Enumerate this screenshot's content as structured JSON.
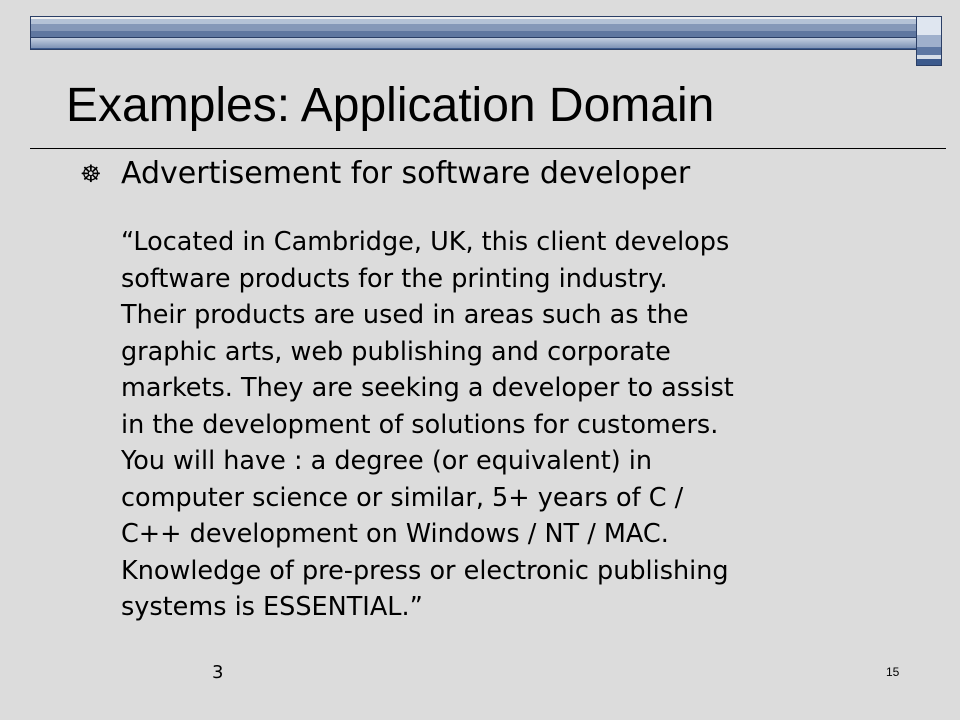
{
  "slide": {
    "title": "Examples: Application Domain",
    "bullet_icon": "☸",
    "bullet_text": "Advertisement for software developer",
    "quote_lines": [
      "“Located in Cambridge, UK, this client develops",
      "software products for the printing industry.",
      "Their products are used in areas such as the",
      "graphic arts, web publishing and corporate",
      "markets. They are seeking a developer to assist",
      "in the development of solutions for customers.",
      "You will have : a degree (or equivalent) in",
      "computer science or similar, 5+ years of C /",
      "C++ development on Windows / NT / MAC.",
      "Knowledge of pre-press or electronic publishing",
      "systems is ESSENTIAL.”"
    ],
    "footer_left": "3",
    "page_number": "15"
  },
  "colors": {
    "background": "#dcdcdc",
    "band_dark": "#3c5a8c",
    "band_light": "#b4c2d6",
    "text": "#000000"
  },
  "icons": {
    "bullet": "wheel-bullet-icon"
  }
}
